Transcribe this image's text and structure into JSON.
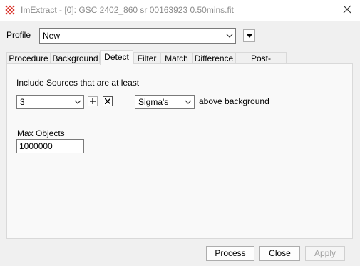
{
  "window": {
    "title": "ImExtract - [0]: GSC 2402_860 sr 00163923 0.50mins.fit"
  },
  "profile": {
    "label": "Profile",
    "value": "New"
  },
  "tabs": [
    {
      "label": "Procedure"
    },
    {
      "label": "Background"
    },
    {
      "label": "Detect"
    },
    {
      "label": "Filter"
    },
    {
      "label": "Match"
    },
    {
      "label": "Difference"
    },
    {
      "label": "Post-process"
    }
  ],
  "active_tab": "Detect",
  "detect": {
    "include_label": "Include Sources that are at least",
    "threshold_value": "3",
    "unit_value": "Sigma's",
    "above_label": "above background",
    "max_objects_label": "Max Objects",
    "max_objects_value": "1000000"
  },
  "buttons": {
    "process": "Process",
    "close": "Close",
    "apply": "Apply"
  },
  "colors": {
    "app_icon": "#d9342b",
    "title_text": "#8b8b8b"
  }
}
